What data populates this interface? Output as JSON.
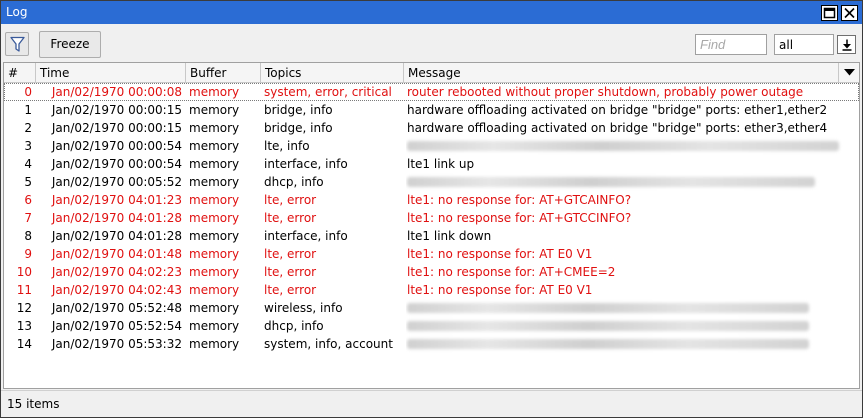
{
  "window": {
    "title": "Log"
  },
  "toolbar": {
    "freeze_label": "Freeze",
    "find_placeholder": "Find",
    "filter_select_value": "all"
  },
  "columns": [
    "#",
    "Time",
    "Buffer",
    "Topics",
    "Message"
  ],
  "rows": [
    {
      "num": "0",
      "time": "Jan/02/1970 00:00:08",
      "buffer": "memory",
      "topics": "system, error, critical",
      "message": "router rebooted without proper shutdown, probably power outage",
      "level": "error",
      "redacted": false
    },
    {
      "num": "1",
      "time": "Jan/02/1970 00:00:15",
      "buffer": "memory",
      "topics": "bridge, info",
      "message": "hardware offloading activated on bridge \"bridge\" ports: ether1,ether2",
      "level": "info",
      "redacted": false
    },
    {
      "num": "2",
      "time": "Jan/02/1970 00:00:15",
      "buffer": "memory",
      "topics": "bridge, info",
      "message": "hardware offloading activated on bridge \"bridge\" ports: ether3,ether4",
      "level": "info",
      "redacted": false
    },
    {
      "num": "3",
      "time": "Jan/02/1970 00:00:54",
      "buffer": "memory",
      "topics": "lte, info",
      "message": "",
      "level": "info",
      "redacted": true
    },
    {
      "num": "4",
      "time": "Jan/02/1970 00:00:54",
      "buffer": "memory",
      "topics": "interface, info",
      "message": "lte1 link up",
      "level": "info",
      "redacted": false
    },
    {
      "num": "5",
      "time": "Jan/02/1970 00:05:52",
      "buffer": "memory",
      "topics": "dhcp, info",
      "message": "",
      "level": "info",
      "redacted": true
    },
    {
      "num": "6",
      "time": "Jan/02/1970 04:01:23",
      "buffer": "memory",
      "topics": "lte, error",
      "message": "lte1: no response for: AT+GTCAINFO?",
      "level": "error",
      "redacted": false
    },
    {
      "num": "7",
      "time": "Jan/02/1970 04:01:28",
      "buffer": "memory",
      "topics": "lte, error",
      "message": "lte1: no response for: AT+GTCCINFO?",
      "level": "error",
      "redacted": false
    },
    {
      "num": "8",
      "time": "Jan/02/1970 04:01:28",
      "buffer": "memory",
      "topics": "interface, info",
      "message": "lte1 link down",
      "level": "info",
      "redacted": false
    },
    {
      "num": "9",
      "time": "Jan/02/1970 04:01:48",
      "buffer": "memory",
      "topics": "lte, error",
      "message": "lte1: no response for: AT E0 V1",
      "level": "error",
      "redacted": false
    },
    {
      "num": "10",
      "time": "Jan/02/1970 04:02:23",
      "buffer": "memory",
      "topics": "lte, error",
      "message": "lte1: no response for: AT+CMEE=2",
      "level": "error",
      "redacted": false
    },
    {
      "num": "11",
      "time": "Jan/02/1970 04:02:43",
      "buffer": "memory",
      "topics": "lte, error",
      "message": "lte1: no response for: AT E0 V1",
      "level": "error",
      "redacted": false
    },
    {
      "num": "12",
      "time": "Jan/02/1970 05:52:48",
      "buffer": "memory",
      "topics": "wireless, info",
      "message": "",
      "level": "info",
      "redacted": true
    },
    {
      "num": "13",
      "time": "Jan/02/1970 05:52:54",
      "buffer": "memory",
      "topics": "dhcp, info",
      "message": "",
      "level": "info",
      "redacted": true
    },
    {
      "num": "14",
      "time": "Jan/02/1970 05:53:32",
      "buffer": "memory",
      "topics": "system, info, account",
      "message": "",
      "level": "info",
      "redacted": true
    }
  ],
  "status": {
    "text": "15 items"
  },
  "colors": {
    "titlebar": "#2b6cd4",
    "error_text": "#e01010"
  },
  "icons": [
    "restore-icon",
    "close-icon",
    "filter-icon",
    "dropdown-arrow-icon",
    "column-menu-icon"
  ]
}
